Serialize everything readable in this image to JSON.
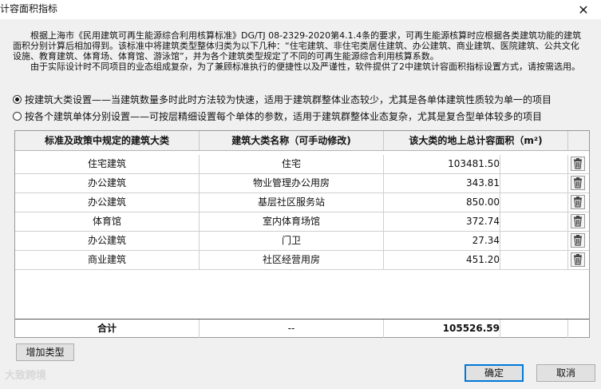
{
  "window": {
    "title": "计容面积指标",
    "close_glyph": "✕"
  },
  "description": {
    "para1": "根据上海市《民用建筑可再生能源综合利用核算标准》DG/TJ 08-2329-2020第4.1.4条的要求，可再生能源核算时应根据各类建筑功能的建筑面积分别计算后相加得到。该标准中将建筑类型整体归类为以下几种：“住宅建筑、非住宅类居住建筑、办公建筑、商业建筑、医院建筑、公共文化设施、教育建筑、体育场、体育馆、游泳馆”，并为各个建筑类型规定了不同的可再生能源综合利用核算系数。",
    "para2": "由于实际设计时不同项目的业态组成复杂，为了兼顾标准执行的便捷性以及严谨性，软件提供了2中建筑计容面积指标设置方式，请按需选用。"
  },
  "options": {
    "by_type": "按建筑大类设置——当建筑数量多时此时方法较为快速，适用于建筑群整体业态较少，尤其是各单体建筑性质较为单一的项目",
    "by_building": "按各个建筑单体分别设置——可按层精细设置每个单体的参数，适用于建筑群整体业态复杂，尤其是复合型单体较多的项目",
    "selected": "by_type"
  },
  "table": {
    "headers": [
      "标准及政策中规定的建筑大类",
      "建筑大类名称（可手动修改)",
      "该大类的地上总计容面积（m²)"
    ],
    "rows": [
      {
        "category": "住宅建筑",
        "name": "住宅",
        "area": "103481.50"
      },
      {
        "category": "办公建筑",
        "name": "物业管理办公用房",
        "area": "343.81"
      },
      {
        "category": "办公建筑",
        "name": "基层社区服务站",
        "area": "850.00"
      },
      {
        "category": "体育馆",
        "name": "室内体育场馆",
        "area": "372.74"
      },
      {
        "category": "办公建筑",
        "name": "门卫",
        "area": "27.34"
      },
      {
        "category": "商业建筑",
        "name": "社区经营用房",
        "area": "451.20"
      }
    ],
    "total": {
      "label": "合计",
      "name": "--",
      "area": "105526.59"
    },
    "delete_icon": "trash-icon"
  },
  "buttons": {
    "add_type": "增加类型",
    "ok": "确定",
    "cancel": "取消"
  },
  "watermark": "大致跨境"
}
